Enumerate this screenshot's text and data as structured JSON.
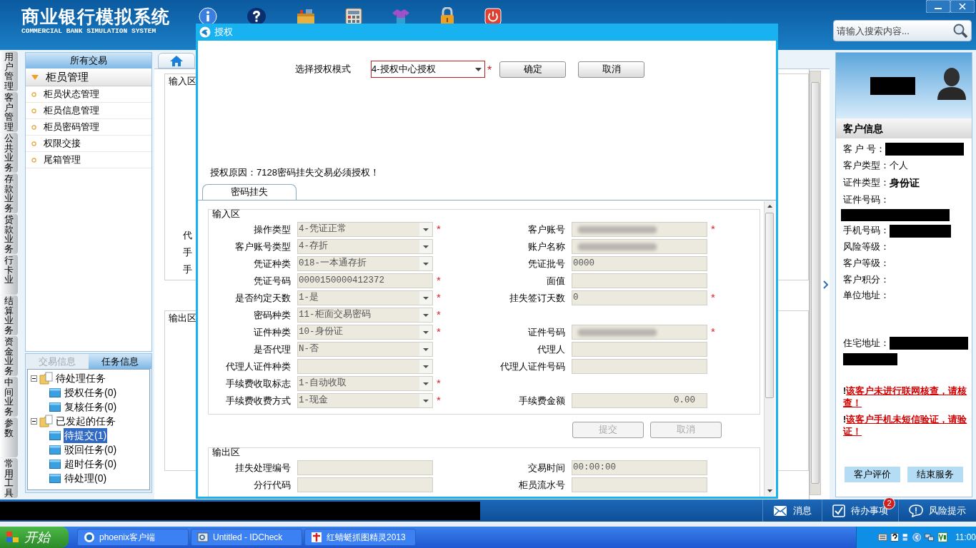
{
  "header": {
    "title": "商业银行模拟系统",
    "subtitle": "COMMERCIAL BANK SIMULATION SYSTEM",
    "tools": [
      {
        "kind": "info"
      },
      {
        "kind": "help"
      },
      {
        "kind": "toolbox"
      },
      {
        "kind": "calculator"
      },
      {
        "kind": "shirt"
      },
      {
        "kind": "lock"
      },
      {
        "kind": "power"
      }
    ],
    "search": {
      "placeholder": "请输入搜索内容..."
    }
  },
  "side_tabs": [
    {
      "label": "用户管理"
    },
    {
      "label": "客户管理"
    },
    {
      "label": "公共业务"
    },
    {
      "label": "存款业务"
    },
    {
      "label": "贷款业务"
    },
    {
      "label": "行卡业"
    },
    {
      "label": "结算业务"
    },
    {
      "label": "资金业务"
    },
    {
      "label": "中间业务"
    },
    {
      "label": "参数"
    },
    {
      "label": "常用工具"
    }
  ],
  "nav": {
    "title": "所有交易",
    "group": {
      "label": "柜员管理",
      "expanded": true
    },
    "items": [
      {
        "label": "柜员状态管理"
      },
      {
        "label": "柜员信息管理"
      },
      {
        "label": "柜员密码管理"
      },
      {
        "label": "权限交接"
      },
      {
        "label": "尾箱管理"
      }
    ]
  },
  "task_panel": {
    "tabs": [
      {
        "label": "交易信息",
        "selected": false
      },
      {
        "label": "任务信息",
        "selected": true
      }
    ],
    "tree": [
      {
        "label": "待处理任务",
        "expanded": true,
        "children": [
          {
            "label": "授权任务(0)",
            "selected": false
          },
          {
            "label": "复核任务(0)",
            "selected": false
          }
        ]
      },
      {
        "label": "已发起的任务",
        "expanded": true,
        "children": [
          {
            "label": "待提交(1)",
            "selected": true
          },
          {
            "label": "驳回任务(0)",
            "selected": false
          },
          {
            "label": "超时任务(0)",
            "selected": false
          },
          {
            "label": "待处理(0)",
            "selected": false
          }
        ]
      }
    ]
  },
  "background_form": {
    "input_section": "输入区",
    "row_labels": [
      "代",
      "手",
      "手"
    ],
    "output_section": "输出区"
  },
  "modal": {
    "title": "授权",
    "mode_label": "选择授权模式",
    "mode_value": "4-授权中心授权",
    "mode_required_mark": "*",
    "buttons": [
      "确定",
      "取消"
    ],
    "reason": "授权原因：7128密码挂失交易必须授权！",
    "tabs": [
      {
        "label": "密码挂失",
        "selected": true
      }
    ],
    "input_section": {
      "title": "输入区",
      "rows": [
        [
          {
            "label": "操作类型",
            "kind": "select",
            "value": "4-凭证正常",
            "required_mark": "*"
          },
          {
            "label": "客户账号",
            "kind": "text",
            "masked": true,
            "required_mark": "*"
          }
        ],
        [
          {
            "label": "客户账号类型",
            "kind": "select",
            "value": "4-存折"
          },
          {
            "label": "账户名称",
            "kind": "text",
            "masked": true
          }
        ],
        [
          {
            "label": "凭证种类",
            "kind": "select",
            "value": "018-一本通存折"
          },
          {
            "label": "凭证批号",
            "kind": "text",
            "value": "0000"
          }
        ],
        [
          {
            "label": "凭证号码",
            "kind": "text",
            "value": "0000150000412372",
            "required_mark": "*"
          },
          {
            "label": "面值",
            "kind": "text"
          }
        ],
        [
          {
            "label": "是否约定天数",
            "kind": "select",
            "value": "1-是",
            "required_mark": "*"
          },
          {
            "label": "挂失签订天数",
            "kind": "text",
            "value": "0",
            "required_mark": "*"
          }
        ],
        [
          {
            "label": "密码种类",
            "kind": "select",
            "value": "11-柜面交易密码",
            "required_mark": "*"
          },
          null
        ],
        [
          {
            "label": "证件种类",
            "kind": "select",
            "value": "10-身份证",
            "required_mark": "*"
          },
          {
            "label": "证件号码",
            "kind": "text",
            "masked": true,
            "required_mark": "*"
          }
        ],
        [
          {
            "label": "是否代理",
            "kind": "select",
            "value": "N-否"
          },
          {
            "label": "代理人",
            "kind": "text"
          }
        ],
        [
          {
            "label": "代理人证件种类",
            "kind": "select"
          },
          {
            "label": "代理人证件号码",
            "kind": "text"
          }
        ],
        [
          {
            "label": "手续费收取标志",
            "kind": "select",
            "value": "1-自动收取",
            "required_mark": "*"
          },
          null
        ],
        [
          {
            "label": "手续费收费方式",
            "kind": "select",
            "value": "1-现金",
            "required_mark": "*"
          },
          {
            "label": "手续费金额",
            "kind": "amount",
            "value": "0.00"
          }
        ]
      ]
    },
    "actions": [
      {
        "label": "提交",
        "disabled": true
      },
      {
        "label": "取消",
        "disabled": true
      }
    ],
    "output_section": {
      "title": "输出区",
      "rows": [
        [
          {
            "label": "挂失处理编号",
            "kind": "text"
          },
          {
            "label": "交易时间",
            "kind": "text",
            "value": "00:00:00"
          }
        ],
        [
          {
            "label": "分行代码",
            "kind": "text"
          },
          {
            "label": "柜员流水号",
            "kind": "text"
          }
        ]
      ]
    }
  },
  "customer": {
    "title": "客户信息",
    "fields": [
      {
        "label": "客 户 号：",
        "redacted": true
      },
      {
        "label": "客户类型：",
        "value": "个人",
        "bold": false
      },
      {
        "label": "证件类型：",
        "value": "身份证",
        "bold": true
      },
      {
        "label": "证件号码：",
        "redacted": true,
        "below": true
      },
      {
        "label": "手机号码：",
        "redacted": true
      },
      {
        "label": "风险等级："
      },
      {
        "label": "客户等级："
      },
      {
        "label": "客户积分："
      },
      {
        "label": "单位地址："
      },
      {
        "label": "住宅地址：",
        "redacted": true,
        "multiline": true
      }
    ],
    "alerts": [
      {
        "mark": "!",
        "text": "该客户未进行联网核查，请核查！"
      },
      {
        "mark": "!",
        "text": "该客户手机未短信验证，请验证！"
      }
    ],
    "buttons": [
      "客户评价",
      "结束服务"
    ]
  },
  "status_bar": {
    "items": [
      {
        "kind": "message",
        "label": "消息"
      },
      {
        "kind": "todo",
        "label": "待办事项",
        "badge": "2"
      },
      {
        "kind": "risk",
        "label": "风险提示"
      }
    ]
  },
  "taskbar": {
    "start": "开始",
    "tasks": [
      {
        "kind": "phoenix",
        "label": "phoenix客户端"
      },
      {
        "kind": "idcheck",
        "label": "Untitled - IDCheck"
      },
      {
        "kind": "capture",
        "label": "红蜻蜓抓图精灵2013"
      }
    ],
    "clock": "11:00"
  }
}
